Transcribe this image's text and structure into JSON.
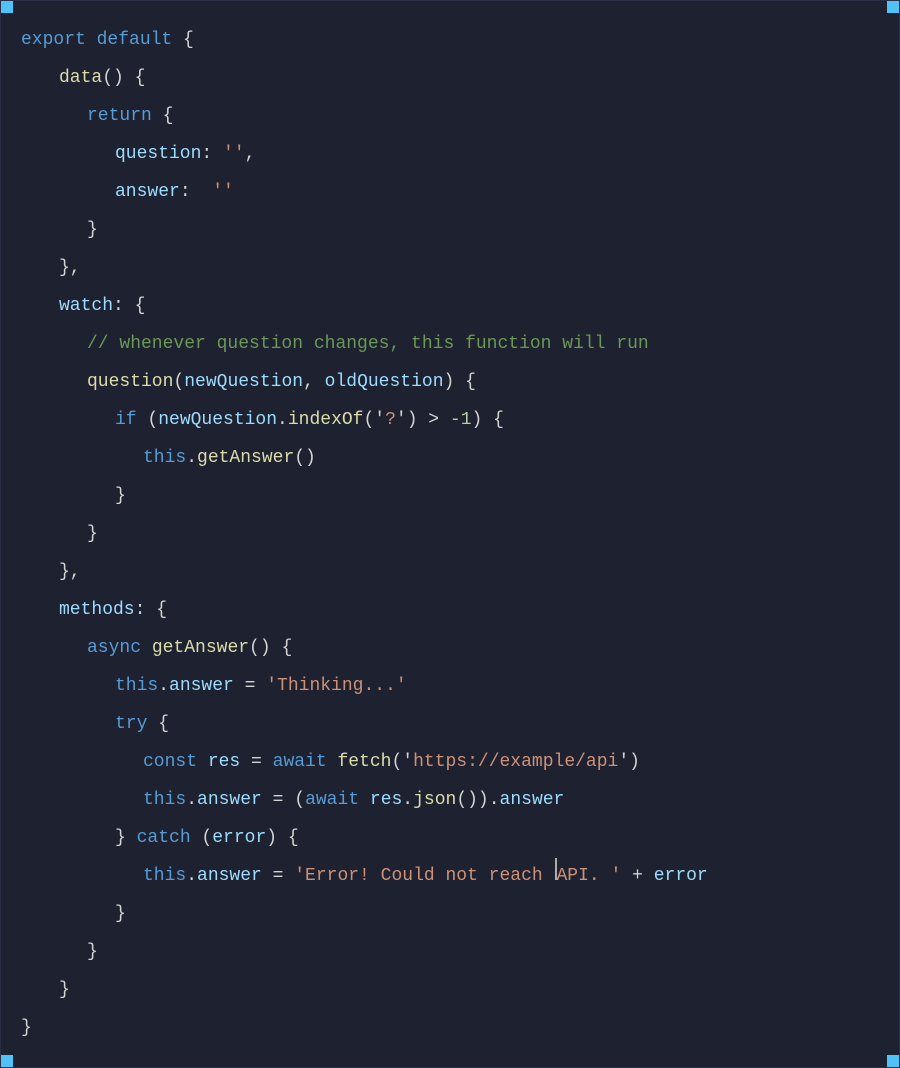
{
  "code": {
    "lines": [
      {
        "indent": 0,
        "tokens": [
          {
            "text": "export",
            "class": "c-keyword"
          },
          {
            "text": " ",
            "class": "c-white"
          },
          {
            "text": "default",
            "class": "c-keyword"
          },
          {
            "text": " {",
            "class": "c-white"
          }
        ]
      },
      {
        "indent": 1,
        "tokens": [
          {
            "text": "data",
            "class": "c-fn"
          },
          {
            "text": "() {",
            "class": "c-white"
          }
        ]
      },
      {
        "indent": 2,
        "tokens": [
          {
            "text": "return",
            "class": "c-keyword"
          },
          {
            "text": " {",
            "class": "c-white"
          }
        ]
      },
      {
        "indent": 3,
        "tokens": [
          {
            "text": "question",
            "class": "c-cyan"
          },
          {
            "text": ": ",
            "class": "c-white"
          },
          {
            "text": "''",
            "class": "c-string"
          },
          {
            "text": ",",
            "class": "c-white"
          }
        ]
      },
      {
        "indent": 3,
        "tokens": [
          {
            "text": "answer",
            "class": "c-cyan"
          },
          {
            "text": ":  ",
            "class": "c-white"
          },
          {
            "text": "''",
            "class": "c-string"
          }
        ]
      },
      {
        "indent": 2,
        "tokens": [
          {
            "text": "}",
            "class": "c-white"
          }
        ]
      },
      {
        "indent": 1,
        "tokens": [
          {
            "text": "},",
            "class": "c-white"
          }
        ]
      },
      {
        "indent": 1,
        "tokens": [
          {
            "text": "watch",
            "class": "c-cyan"
          },
          {
            "text": ": {",
            "class": "c-white"
          }
        ]
      },
      {
        "indent": 2,
        "tokens": [
          {
            "text": "// whenever question changes, this function will run",
            "class": "c-comment"
          }
        ]
      },
      {
        "indent": 2,
        "tokens": [
          {
            "text": "question",
            "class": "c-fn"
          },
          {
            "text": "(",
            "class": "c-white"
          },
          {
            "text": "newQuestion",
            "class": "c-cyan"
          },
          {
            "text": ", ",
            "class": "c-white"
          },
          {
            "text": "oldQuestion",
            "class": "c-cyan"
          },
          {
            "text": ") {",
            "class": "c-white"
          }
        ]
      },
      {
        "indent": 3,
        "tokens": [
          {
            "text": "if",
            "class": "c-keyword"
          },
          {
            "text": " (",
            "class": "c-white"
          },
          {
            "text": "newQuestion",
            "class": "c-cyan"
          },
          {
            "text": ".",
            "class": "c-white"
          },
          {
            "text": "indexOf",
            "class": "c-fn"
          },
          {
            "text": "('",
            "class": "c-white"
          },
          {
            "text": "?",
            "class": "c-string"
          },
          {
            "text": "') > ",
            "class": "c-white"
          },
          {
            "text": "-1",
            "class": "c-number"
          },
          {
            "text": ") {",
            "class": "c-white"
          }
        ]
      },
      {
        "indent": 4,
        "tokens": [
          {
            "text": "this",
            "class": "c-keyword"
          },
          {
            "text": ".",
            "class": "c-white"
          },
          {
            "text": "getAnswer",
            "class": "c-fn"
          },
          {
            "text": "()",
            "class": "c-white"
          }
        ]
      },
      {
        "indent": 3,
        "tokens": [
          {
            "text": "}",
            "class": "c-white"
          }
        ]
      },
      {
        "indent": 2,
        "tokens": [
          {
            "text": "}",
            "class": "c-white"
          }
        ]
      },
      {
        "indent": 1,
        "tokens": [
          {
            "text": "},",
            "class": "c-white"
          }
        ]
      },
      {
        "indent": 1,
        "tokens": [
          {
            "text": "methods",
            "class": "c-cyan"
          },
          {
            "text": ": {",
            "class": "c-white"
          }
        ]
      },
      {
        "indent": 2,
        "tokens": [
          {
            "text": "async",
            "class": "c-keyword"
          },
          {
            "text": " ",
            "class": "c-white"
          },
          {
            "text": "getAnswer",
            "class": "c-fn"
          },
          {
            "text": "() {",
            "class": "c-white"
          }
        ]
      },
      {
        "indent": 3,
        "tokens": [
          {
            "text": "this",
            "class": "c-keyword"
          },
          {
            "text": ".",
            "class": "c-white"
          },
          {
            "text": "answer",
            "class": "c-cyan"
          },
          {
            "text": " = ",
            "class": "c-white"
          },
          {
            "text": "'Thinking...'",
            "class": "c-string"
          }
        ]
      },
      {
        "indent": 3,
        "tokens": [
          {
            "text": "try",
            "class": "c-keyword"
          },
          {
            "text": " {",
            "class": "c-white"
          }
        ]
      },
      {
        "indent": 4,
        "tokens": [
          {
            "text": "const",
            "class": "c-keyword"
          },
          {
            "text": " ",
            "class": "c-white"
          },
          {
            "text": "res",
            "class": "c-cyan"
          },
          {
            "text": " = ",
            "class": "c-white"
          },
          {
            "text": "await",
            "class": "c-keyword"
          },
          {
            "text": " ",
            "class": "c-white"
          },
          {
            "text": "fetch",
            "class": "c-fn"
          },
          {
            "text": "('",
            "class": "c-white"
          },
          {
            "text": "https://example/api",
            "class": "c-string"
          },
          {
            "text": "')",
            "class": "c-white"
          }
        ]
      },
      {
        "indent": 4,
        "tokens": [
          {
            "text": "this",
            "class": "c-keyword"
          },
          {
            "text": ".",
            "class": "c-white"
          },
          {
            "text": "answer",
            "class": "c-cyan"
          },
          {
            "text": " = (",
            "class": "c-white"
          },
          {
            "text": "await",
            "class": "c-keyword"
          },
          {
            "text": " ",
            "class": "c-white"
          },
          {
            "text": "res",
            "class": "c-cyan"
          },
          {
            "text": ".",
            "class": "c-white"
          },
          {
            "text": "json",
            "class": "c-fn"
          },
          {
            "text": "()).",
            "class": "c-white"
          },
          {
            "text": "answer",
            "class": "c-cyan"
          }
        ]
      },
      {
        "indent": 3,
        "tokens": [
          {
            "text": "} ",
            "class": "c-white"
          },
          {
            "text": "catch",
            "class": "c-keyword"
          },
          {
            "text": " (",
            "class": "c-white"
          },
          {
            "text": "error",
            "class": "c-cyan"
          },
          {
            "text": ") {",
            "class": "c-white"
          }
        ]
      },
      {
        "indent": 4,
        "tokens": [
          {
            "text": "this",
            "class": "c-keyword"
          },
          {
            "text": ".",
            "class": "c-white"
          },
          {
            "text": "answer",
            "class": "c-cyan"
          },
          {
            "text": " = ",
            "class": "c-white"
          },
          {
            "text": "'Error! Could not reach ",
            "class": "c-string"
          },
          {
            "text": "cursor",
            "class": "cursor-marker"
          },
          {
            "text": "API. '",
            "class": "c-string"
          },
          {
            "text": " + ",
            "class": "c-white"
          },
          {
            "text": "error",
            "class": "c-cyan"
          }
        ]
      },
      {
        "indent": 3,
        "tokens": [
          {
            "text": "}",
            "class": "c-white"
          }
        ]
      },
      {
        "indent": 2,
        "tokens": [
          {
            "text": "}",
            "class": "c-white"
          }
        ]
      },
      {
        "indent": 1,
        "tokens": [
          {
            "text": "}",
            "class": "c-white"
          }
        ]
      },
      {
        "indent": 0,
        "tokens": [
          {
            "text": "}",
            "class": "c-white"
          }
        ]
      }
    ]
  }
}
